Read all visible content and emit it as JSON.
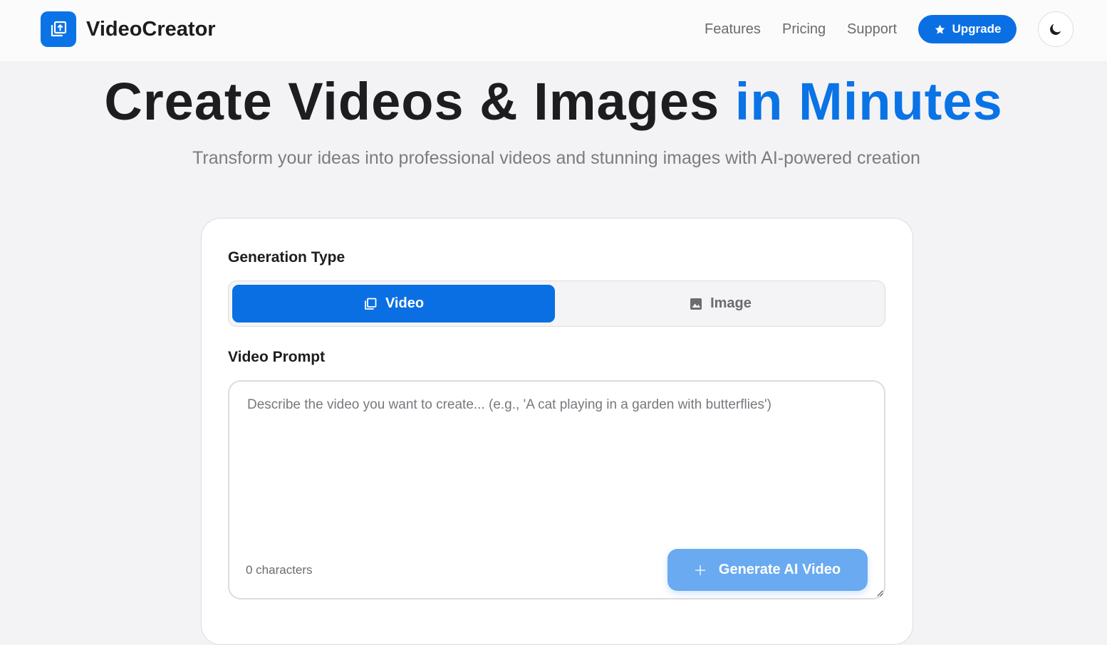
{
  "header": {
    "brand": "VideoCreator",
    "logo_icon": "video-frame-upload-icon",
    "nav": [
      {
        "label": "Features"
      },
      {
        "label": "Pricing"
      },
      {
        "label": "Support"
      }
    ],
    "upgrade_label": "Upgrade",
    "upgrade_icon": "star-icon",
    "theme_icon": "moon-icon"
  },
  "hero": {
    "title_main": "Create Videos & Images ",
    "title_accent": "in Minutes",
    "subtitle": "Transform your ideas into professional videos and stunning images with AI-powered creation"
  },
  "form": {
    "type_label": "Generation Type",
    "types": [
      {
        "label": "Video",
        "icon": "video-frames-icon",
        "selected": true
      },
      {
        "label": "Image",
        "icon": "image-icon",
        "selected": false
      }
    ],
    "prompt_label": "Video Prompt",
    "prompt_value": "",
    "prompt_placeholder": "Describe the video you want to create... (e.g., 'A cat playing in a garden with butterflies')",
    "char_count": "0 characters",
    "generate_label": "Generate AI Video",
    "generate_icon": "sparkle-icon"
  },
  "colors": {
    "accent": "#0a73e6",
    "button_disabled": "#6aaaf0",
    "background": "#f3f3f5"
  }
}
